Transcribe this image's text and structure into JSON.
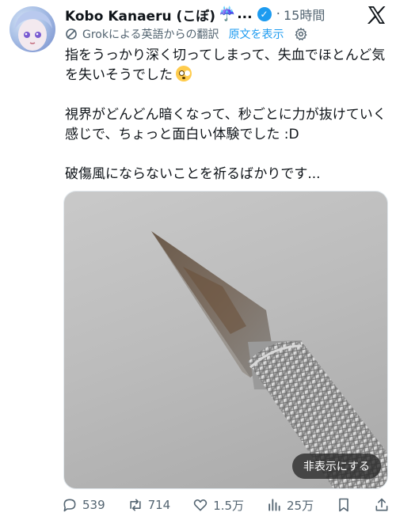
{
  "author": {
    "name": "Kobo Kanaeru (こぼ)",
    "ellipsis": "...",
    "emoji": "☔️",
    "timestamp": "15時間"
  },
  "translation": {
    "note": "Grokによる英語からの翻訳",
    "show_original": "原文を表示"
  },
  "tweet": {
    "paragraph1": "指をうっかり深く切ってしまって、失血でほとんど気を失いそうでした",
    "paragraph2": "視界がどんどん暗くなって、秒ごとに力が抜けていく感じで、ちょっと面白い体験でした :D",
    "paragraph3": "破傷風にならないことを祈るばかりです..."
  },
  "media": {
    "hide_label": "非表示にする"
  },
  "actions": {
    "replies": "539",
    "reposts": "714",
    "likes": "1.5万",
    "views": "25万"
  },
  "icons": {
    "verified": "verified-badge-icon",
    "x_logo": "x-logo-icon",
    "translate": "translate-icon",
    "settings": "gear-icon",
    "reply": "reply-icon",
    "repost": "repost-icon",
    "like": "heart-icon",
    "views": "bar-chart-icon",
    "bookmark": "bookmark-icon",
    "share": "share-icon"
  },
  "colors": {
    "link": "#1d9bf0",
    "secondary_text": "#536471"
  }
}
